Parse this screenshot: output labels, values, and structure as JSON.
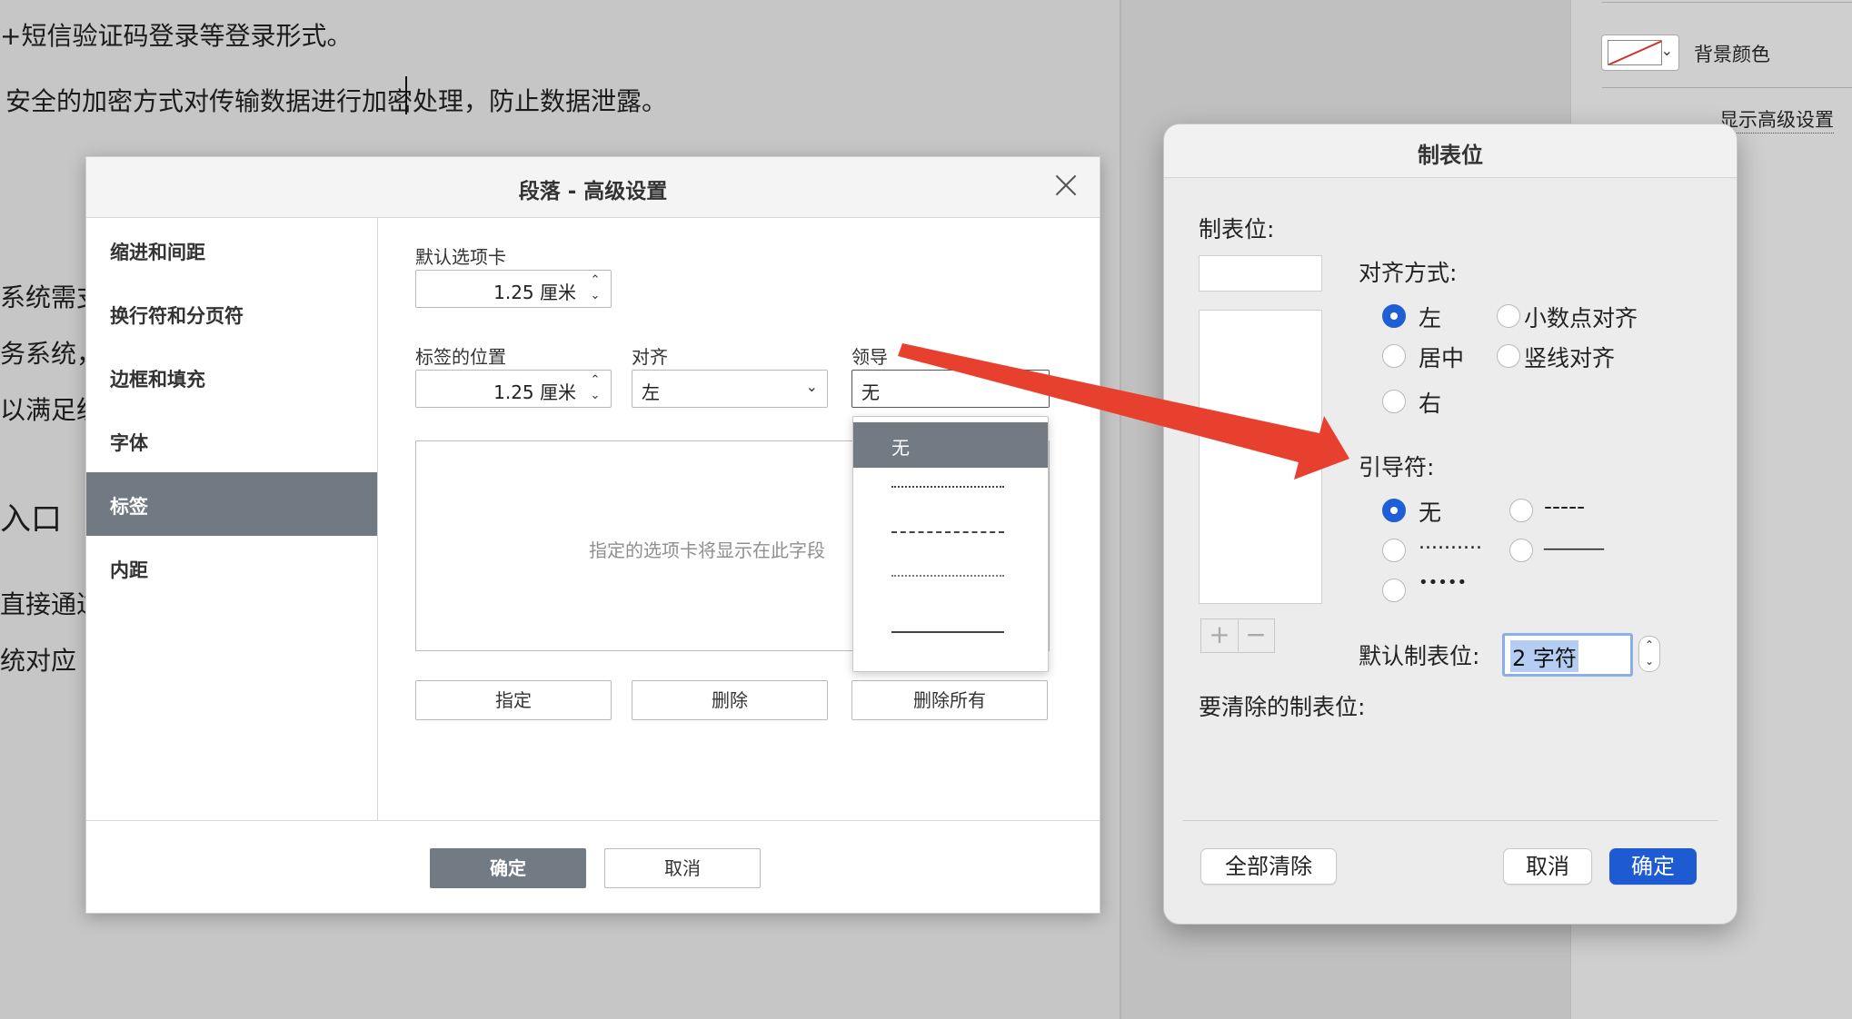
{
  "document": {
    "lines": [
      "+短信验证码登录等登录形式。",
      "安全的加密方式对传输数据进行加密处理，防止数据泄露。",
      "系统需支",
      "务系统，",
      "以满足统",
      "入口",
      "直接通过",
      "统对应"
    ]
  },
  "sidebar_right": {
    "bg_color_label": "背景颜色",
    "advanced_link": "显示高级设置"
  },
  "dialog_paragraph": {
    "title": "段落 - 高级设置",
    "nav": [
      "缩进和间距",
      "换行符和分页符",
      "边框和填充",
      "字体",
      "标签",
      "内距"
    ],
    "active_nav": "标签",
    "default_tab_label": "默认选项卡",
    "default_tab_value": "1.25 厘米",
    "tab_position_label": "标签的位置",
    "tab_position_value": "1.25 厘米",
    "align_label": "对齐",
    "align_value": "左",
    "leader_label": "领导",
    "leader_value": "无",
    "placeholder": "指定的选项卡将显示在此字段",
    "buttons": {
      "specify": "指定",
      "delete": "删除",
      "delete_all": "删除所有"
    },
    "ok": "确定",
    "cancel": "取消",
    "leader_options": [
      "无",
      "dotted",
      "dashed",
      "dotted-fine",
      "underline"
    ]
  },
  "dialog_tabstops": {
    "title": "制表位",
    "tabstop_label": "制表位:",
    "alignment_label": "对齐方式:",
    "alignment_options": [
      "左",
      "小数点对齐",
      "居中",
      "竖线对齐",
      "右"
    ],
    "alignment_selected": "左",
    "leader_label": "引导符:",
    "leader_options": [
      "无",
      "-----",
      "..........",
      "______",
      "•••••"
    ],
    "leader_selected": "无",
    "default_tabstop_label": "默认制表位:",
    "default_tabstop_value": "2 字符",
    "clear_label": "要清除的制表位:",
    "clear_all": "全部清除",
    "cancel": "取消",
    "ok": "确定"
  },
  "colors": {
    "accent_blue": "#1e5bd3",
    "active_gray": "#727a84",
    "arrow_red": "#e8402f"
  }
}
